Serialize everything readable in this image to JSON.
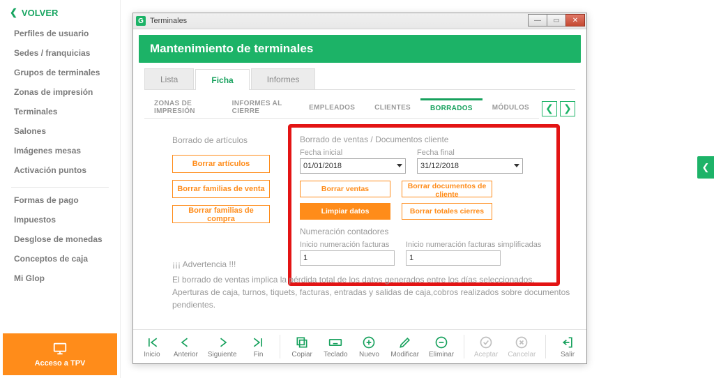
{
  "sidebar": {
    "back": "VOLVER",
    "group1": [
      "Perfiles de usuario",
      "Sedes / franquicias",
      "Grupos de terminales",
      "Zonas de impresión",
      "Terminales",
      "Salones",
      "Imágenes mesas",
      "Activación puntos"
    ],
    "group2": [
      "Formas de pago",
      "Impuestos",
      "Desglose de monedas",
      "Conceptos de caja",
      "Mi Glop"
    ],
    "tpv": "Acceso a TPV"
  },
  "window": {
    "title": "Terminales",
    "header": "Mantenimiento de terminales",
    "tabs": [
      "Lista",
      "Ficha",
      "Informes"
    ],
    "active_tab": "Ficha",
    "subtabs": [
      "ZONAS DE IMPRESIÓN",
      "INFORMES AL CIERRE",
      "EMPLEADOS",
      "CLIENTES",
      "BORRADOS",
      "MÓDULOS"
    ],
    "active_subtab": "BORRADOS"
  },
  "borrado_articulos": {
    "title": "Borrado de artículos",
    "btns": [
      "Borrar artículos",
      "Borrar familias de venta",
      "Borrar familias de compra"
    ]
  },
  "borrado_ventas": {
    "title": "Borrado de ventas / Documentos cliente",
    "fecha_inicial_label": "Fecha inicial",
    "fecha_final_label": "Fecha final",
    "fecha_inicial": "01/01/2018",
    "fecha_final": "31/12/2018",
    "btns": {
      "bv": "Borrar ventas",
      "bdc": "Borrar documentos de cliente",
      "ld": "Limpiar datos",
      "btc": "Borrar totales cierres"
    },
    "num_title": "Numeración contadores",
    "num_fact_label": "Inicio numeración facturas",
    "num_simp_label": "Inicio numeración facturas simplificadas",
    "num_fact": "1",
    "num_simp": "1"
  },
  "warning": {
    "h": "¡¡¡ Advertencia !!!",
    "l1": "El borrado de ventas implica la pérdida total de los datos generados entre los días seleccionados.",
    "l2": "Aperturas de caja, turnos, tiquets, facturas, entradas y salidas de caja,cobros realizados sobre documentos pendientes."
  },
  "toolbar": {
    "inicio": "Inicio",
    "anterior": "Anterior",
    "siguiente": "Siguiente",
    "fin": "Fin",
    "copiar": "Copiar",
    "teclado": "Teclado",
    "nuevo": "Nuevo",
    "modificar": "Modificar",
    "eliminar": "Eliminar",
    "aceptar": "Aceptar",
    "cancelar": "Cancelar",
    "salir": "Salir"
  }
}
